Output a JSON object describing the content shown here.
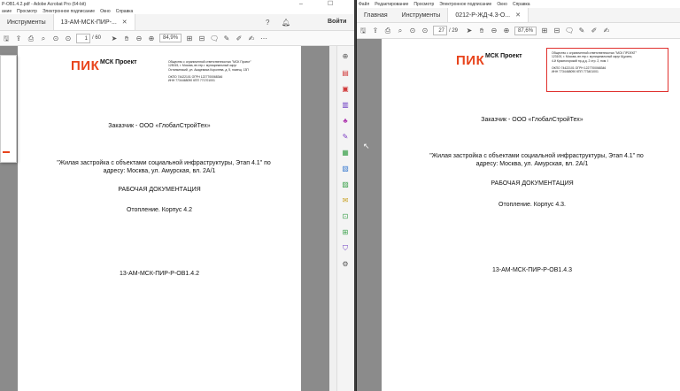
{
  "left": {
    "title": "Р-ОВ1.4.2.pdf - Adobe Acrobat Pro (64-bit)",
    "menu": [
      "ание",
      "Просмотр",
      "Электронное подписание",
      "Окно",
      "Справка"
    ],
    "tabs": {
      "tools": "Инструменты",
      "doc": "13-АМ-МСК-ПИР-..."
    },
    "signin": "Войти",
    "page_current": "1",
    "page_total": "/ 60",
    "zoom": "84,9%",
    "doc": {
      "logo": "ПИК",
      "logo_sub": "МСК Проект",
      "org": [
        "Общество с ограниченной ответственностью \"МСК Проект\"",
        "125015, г. Москва, вн.тер.г. муниципальный округ",
        "Останкинский, ул. Академика Королева, д. 5, помещ. 13П",
        "",
        "ОКПО 74422101 ОГРН 1227700068346",
        "ИНН 7734468090 КПП 771701001"
      ],
      "customer": "Заказчик - ООО «ГлобалСтройТех»",
      "project_l1": "\"Жилая застройка с объектами социальной инфраструктуры, Этап 4.1\" по",
      "project_l2": "адресу: Москва, ул. Амурская, вл. 2А/1",
      "type": "РАБОЧАЯ ДОКУМЕНТАЦИЯ",
      "section": "Отопление. Корпус 4.2",
      "code": "13-АМ-МСК-ПИР-Р-ОВ1.4.2"
    }
  },
  "right": {
    "menu": [
      "Файл",
      "Редактирование",
      "Просмотр",
      "Электронное подписание",
      "Окно",
      "Справка"
    ],
    "tabs": {
      "home": "Главная",
      "tools": "Инструменты",
      "doc": "0212-Р-ЖД-4.3-О..."
    },
    "page_current": "27",
    "page_total": "/ 29",
    "zoom": "87,6%",
    "doc": {
      "logo": "ПИК",
      "logo_sub": "МСК Проект",
      "org": [
        "Общество с ограниченной ответственностью \"МСК ПРОЕКТ\"",
        "123100, г. Москва, вн.тер.г. муниципальный округ Щукино,",
        "4-й Красногорский пр-д д. 2 стр. 2, пом. I",
        "",
        "ОКПО 74422101 ОГРН 1227700068346",
        "ИНН 7734468090 КПП 773401001"
      ],
      "customer": "Заказчик - ООО «ГлобалСтройТех»",
      "project_l1": "\"Жилая застройка с объектами социальной инфраструктуры, Этап 4.1\" по",
      "project_l2": "адресу: Москва, ул. Амурская, вл. 2А/1",
      "type": "РАБОЧАЯ ДОКУМЕНТАЦИЯ",
      "section": "Отопление. Корпус 4.3.",
      "code": "13-АМ-МСК-ПИР-Р-ОВ1.4.3"
    }
  },
  "colors": {
    "accent": "#e8441c",
    "highlight_box": "#e0312e",
    "canvas": "#8b8b8b"
  }
}
